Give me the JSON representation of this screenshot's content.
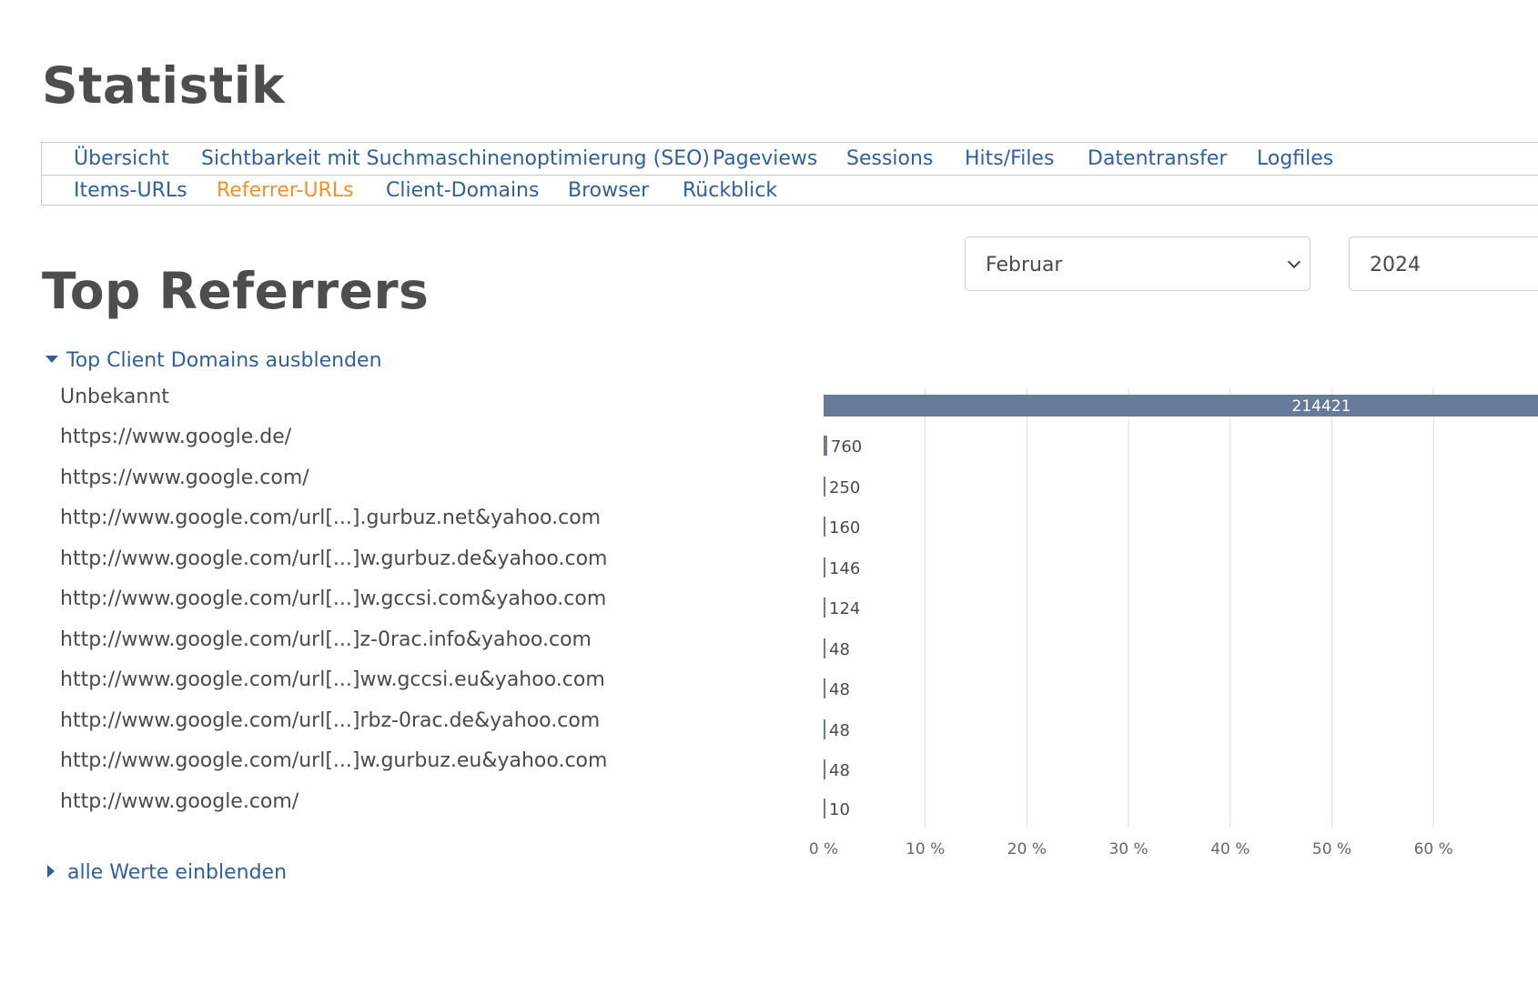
{
  "page": {
    "title": "Statistik"
  },
  "nav": {
    "row1": [
      {
        "label": "Übersicht"
      },
      {
        "label": "Sichtbarkeit mit Suchmaschinenoptimierung (SEO)"
      },
      {
        "label": "Pageviews"
      },
      {
        "label": "Sessions"
      },
      {
        "label": "Hits/Files"
      },
      {
        "label": "Datentransfer"
      },
      {
        "label": "Logfiles"
      }
    ],
    "row2": [
      {
        "label": "Items-URLs"
      },
      {
        "label": "Referrer-URLs",
        "active": true
      },
      {
        "label": "Client-Domains"
      },
      {
        "label": "Browser"
      },
      {
        "label": "Rückblick"
      }
    ]
  },
  "filters": {
    "month": "Februar",
    "year": "2024"
  },
  "section": {
    "title": "Top Referrers",
    "toggle_hide": "Top Client Domains ausblenden",
    "toggle_show_all": "alle Werte einblenden"
  },
  "colors": {
    "bar": "#677a99",
    "link": "#2f5f9e",
    "active": "#f0902a"
  },
  "chart_data": {
    "type": "bar",
    "orientation": "horizontal",
    "categories": [
      "Unbekannt",
      "https://www.google.de/",
      "https://www.google.com/",
      "http://www.google.com/url[...].gurbuz.net&yahoo.com",
      "http://www.google.com/url[...]w.gurbuz.de&yahoo.com",
      "http://www.google.com/url[...]w.gccsi.com&yahoo.com",
      "http://www.google.com/url[...]z-0rac.info&yahoo.com",
      "http://www.google.com/url[...]ww.gccsi.eu&yahoo.com",
      "http://www.google.com/url[...]rbz-0rac.de&yahoo.com",
      "http://www.google.com/url[...]w.gurbuz.eu&yahoo.com",
      "http://www.google.com/"
    ],
    "values": [
      214421,
      760,
      250,
      160,
      146,
      124,
      48,
      48,
      48,
      48,
      10
    ],
    "value_labels": [
      "214421",
      "760",
      "250",
      "160",
      "146",
      "124",
      "48",
      "48",
      "48",
      "48",
      "10"
    ],
    "percentages": [
      98.36,
      0.35,
      0.11,
      0.07,
      0.07,
      0.06,
      0.02,
      0.02,
      0.02,
      0.02,
      0.005
    ],
    "xticks": [
      "0 %",
      "10 %",
      "20 %",
      "30 %",
      "40 %",
      "50 %",
      "60 %"
    ],
    "xlim": [
      0,
      100
    ],
    "grid": true
  }
}
